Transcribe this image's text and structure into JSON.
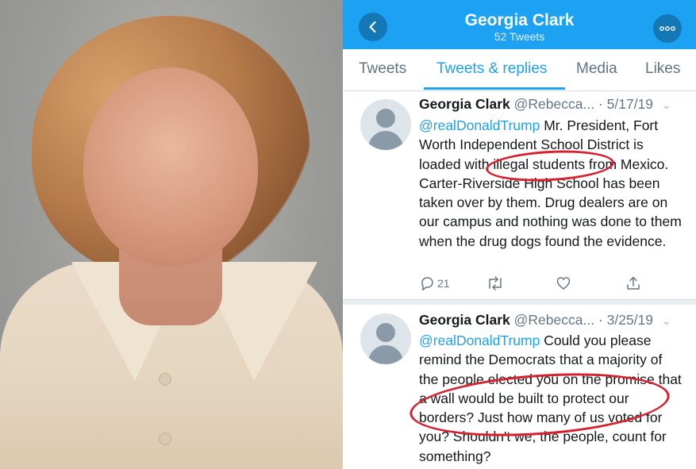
{
  "header": {
    "title": "Georgia Clark",
    "subtitle": "52 Tweets"
  },
  "tabs": [
    "Tweets",
    "Tweets & replies",
    "Media",
    "Likes"
  ],
  "tweets": [
    {
      "name": "Georgia Clark",
      "handle": "@Rebecca... · 5/17/19",
      "mention": "@realDonaldTrump",
      "text": " Mr. President, Fort Worth Independent School District is loaded with illegal students from Mexico.  Carter-Riverside High School has been taken over by them.  Drug dealers are on our campus and nothing was done to them when the drug dogs found the evidence.",
      "reply_count": "21"
    },
    {
      "name": "Georgia Clark",
      "handle": "@Rebecca... · 3/25/19",
      "mention": "@realDonaldTrump",
      "text": " Could you please remind the Democrats that a majority of the people elected you on the promise that a wall would be built to protect our borders? Just how many of us voted for you?  Shouldn't we, the people, count for something?"
    }
  ],
  "colors": {
    "brand": "#1da1f2",
    "annotation": "#d8212f"
  },
  "icons": [
    "back-arrow-icon",
    "more-icon",
    "reply-icon",
    "retweet-icon",
    "like-icon",
    "share-icon",
    "chevron-down-icon"
  ]
}
